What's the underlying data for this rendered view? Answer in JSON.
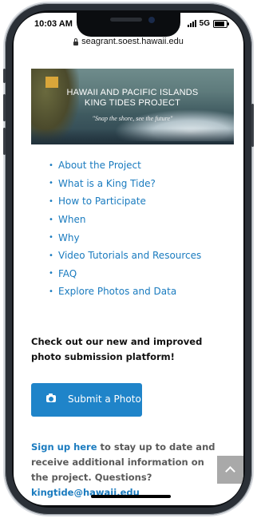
{
  "status_bar": {
    "time": "10:03 AM",
    "network": "5G"
  },
  "browser": {
    "url": "seagrant.soest.hawaii.edu"
  },
  "banner": {
    "title_line1": "HAWAII AND PACIFIC ISLANDS",
    "title_line2": "KING TIDES PROJECT",
    "tagline": "\"Snap the shore, see the future\""
  },
  "nav": {
    "items": [
      {
        "label": "About the Project"
      },
      {
        "label": "What is a King Tide?"
      },
      {
        "label": "How to Participate"
      },
      {
        "label": "When"
      },
      {
        "label": "Why"
      },
      {
        "label": "Video Tutorials and Resources"
      },
      {
        "label": "FAQ"
      },
      {
        "label": "Explore Photos and Data"
      }
    ]
  },
  "callout": {
    "text": "Check out our new and improved photo submission platform!"
  },
  "submit_button": {
    "label": "Submit a Photo",
    "icon": "camera-icon"
  },
  "signup": {
    "link": "Sign up here",
    "text": " to stay up to date and receive additional information on the project. Questions? ",
    "email": "kingtide@hawaii.edu"
  },
  "colors": {
    "link": "#1a7bbf",
    "button": "#1f84c9",
    "scroll_button": "#a9a9a9"
  }
}
